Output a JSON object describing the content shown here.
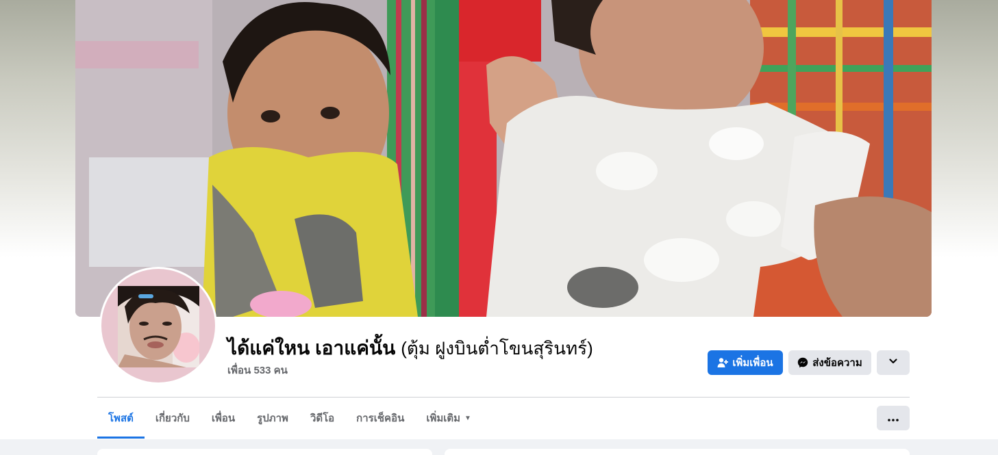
{
  "profile": {
    "name": "ได้แค่ใหน เอาแค่นั้น",
    "alternate_name": "(ตุ้ม ฝูงบินต่ำโขนสุรินทร์)",
    "friends_count": "เพื่อน 533 คน"
  },
  "actions": {
    "add_friend": "เพิ่มเพื่อน",
    "message": "ส่งข้อความ"
  },
  "tabs": [
    {
      "label": "โพสต์",
      "active": true
    },
    {
      "label": "เกี่ยวกับ",
      "active": false
    },
    {
      "label": "เพื่อน",
      "active": false
    },
    {
      "label": "รูปภาพ",
      "active": false
    },
    {
      "label": "วิดีโอ",
      "active": false
    },
    {
      "label": "การเช็คอิน",
      "active": false
    },
    {
      "label": "เพิ่มเติม",
      "active": false
    }
  ],
  "colors": {
    "accent": "#1b74e4",
    "secondary_button": "#e4e6eb",
    "muted_text": "#65676b",
    "page_background": "#f0f2f5"
  },
  "icons": {
    "add_friend": "person-plus-icon",
    "message": "messenger-icon",
    "dropdown": "chevron-down-icon",
    "more_options": "ellipsis-icon",
    "tab_more": "caret-down-icon"
  }
}
